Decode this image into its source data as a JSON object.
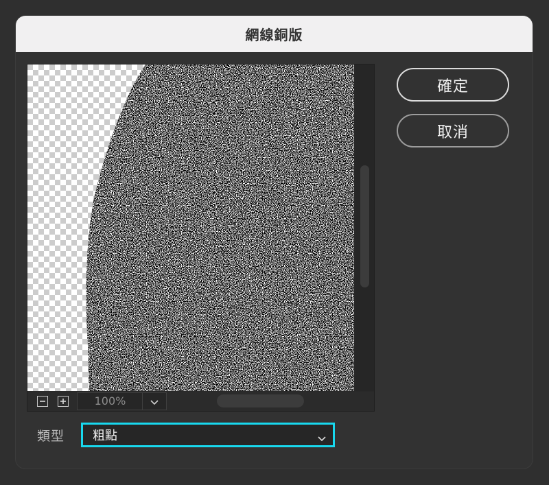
{
  "dialog": {
    "title": "網線銅版"
  },
  "preview": {
    "zoom_out_icon": "minus-square-icon",
    "zoom_in_icon": "plus-square-icon",
    "zoom_value": "100%",
    "zoom_dropdown_icon": "chevron-down-icon"
  },
  "buttons": {
    "ok_label": "確定",
    "cancel_label": "取消"
  },
  "type_field": {
    "label": "類型",
    "selected": "粗點",
    "dropdown_icon": "chevron-down-icon",
    "focus_color": "#18d8ee"
  }
}
